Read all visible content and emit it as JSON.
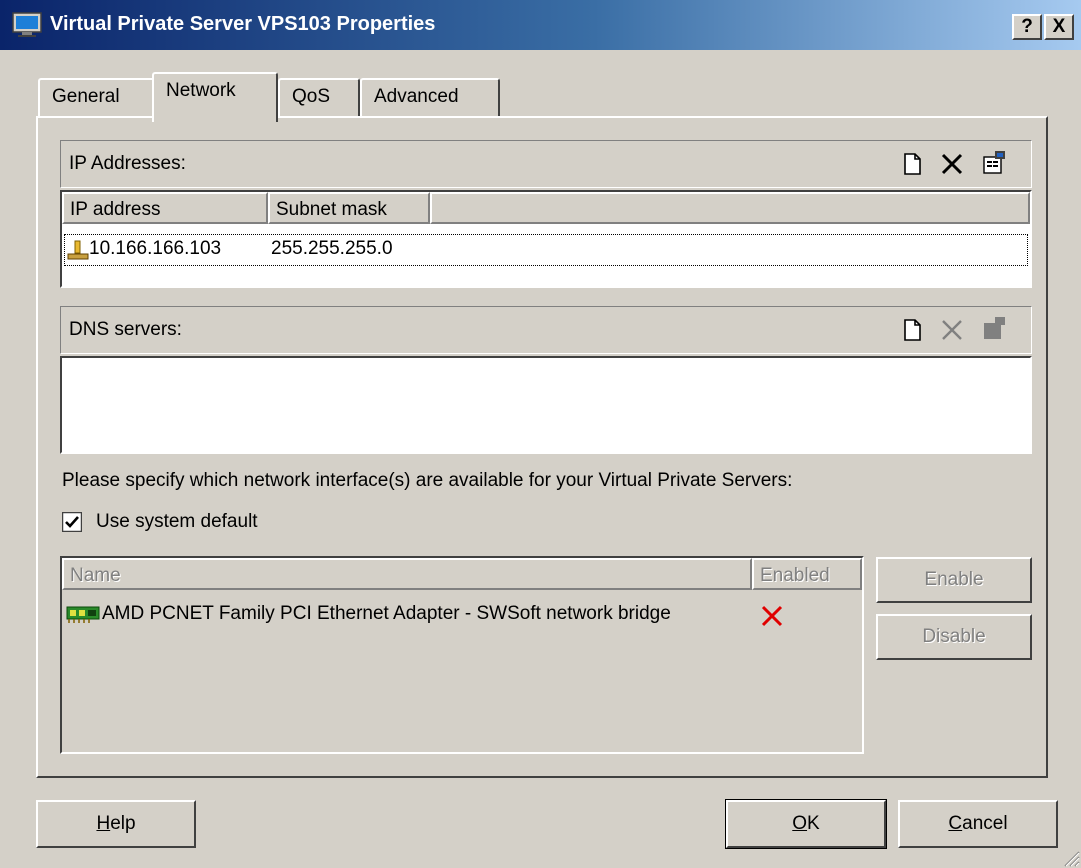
{
  "window": {
    "title": "Virtual Private Server VPS103 Properties",
    "help_btn": "?",
    "close_btn": "X"
  },
  "tabs": [
    {
      "label": "General"
    },
    {
      "label": "Network"
    },
    {
      "label": "QoS"
    },
    {
      "label": "Advanced"
    }
  ],
  "active_tab": "Network",
  "ip_section": {
    "label": "IP Addresses:",
    "toolbar": [
      "new-item-icon",
      "delete-x-icon",
      "properties-icon"
    ],
    "columns": [
      "IP address",
      "Subnet mask"
    ],
    "rows": [
      {
        "icon": "network-connection-icon",
        "ip": "10.166.166.103",
        "mask": "255.255.255.0"
      }
    ]
  },
  "dns_section": {
    "label": "DNS servers:",
    "toolbar": [
      "new-item-icon",
      "delete-x-icon",
      "properties-icon"
    ],
    "rows": []
  },
  "interfaces": {
    "instruction": "Please specify which network interface(s) are available for your Virtual Private Servers:",
    "use_default_label": "Use system default",
    "use_default_checked": true,
    "columns": [
      "Name",
      "Enabled"
    ],
    "rows": [
      {
        "icon": "network-adapter-icon",
        "name": "AMD PCNET Family PCI Ethernet Adapter - SWSoft network bridge",
        "enabled_icon": "red-x-icon"
      }
    ],
    "enable_button": "Enable",
    "disable_button": "Disable"
  },
  "footer": {
    "help_prefix": "",
    "help_mnemonic": "H",
    "help_rest": "elp",
    "ok_mnemonic": "O",
    "ok_rest": "K",
    "cancel_mnemonic": "C",
    "cancel_rest": "ancel"
  },
  "colors": {
    "title_start": "#0a246a",
    "title_end": "#a6caf0",
    "face": "#d4d0c8",
    "x_red": "#e00000"
  }
}
